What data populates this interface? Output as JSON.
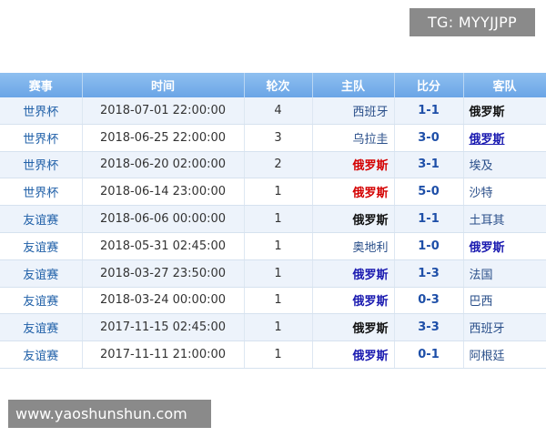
{
  "watermark_top": "TG: MYYJJPP",
  "watermark_bottom": "www.yaoshunshun.com",
  "headers": [
    "赛事",
    "时间",
    "轮次",
    "主队",
    "比分",
    "客队"
  ],
  "rows": [
    {
      "event": "世界杯",
      "time": "2018-07-01 22:00:00",
      "round": "4",
      "home": "西班牙",
      "home_style": "normal",
      "score": "1-1",
      "away": "俄罗斯",
      "away_style": "black"
    },
    {
      "event": "世界杯",
      "time": "2018-06-25 22:00:00",
      "round": "3",
      "home": "乌拉圭",
      "home_style": "normal",
      "score": "3-0",
      "away": "俄罗斯",
      "away_style": "link"
    },
    {
      "event": "世界杯",
      "time": "2018-06-20 02:00:00",
      "round": "2",
      "home": "俄罗斯",
      "home_style": "red",
      "score": "3-1",
      "away": "埃及",
      "away_style": "normal"
    },
    {
      "event": "世界杯",
      "time": "2018-06-14 23:00:00",
      "round": "1",
      "home": "俄罗斯",
      "home_style": "red",
      "score": "5-0",
      "away": "沙特",
      "away_style": "normal"
    },
    {
      "event": "友谊赛",
      "time": "2018-06-06 00:00:00",
      "round": "1",
      "home": "俄罗斯",
      "home_style": "black",
      "score": "1-1",
      "away": "土耳其",
      "away_style": "normal"
    },
    {
      "event": "友谊赛",
      "time": "2018-05-31 02:45:00",
      "round": "1",
      "home": "奥地利",
      "home_style": "normal",
      "score": "1-0",
      "away": "俄罗斯",
      "away_style": "blue"
    },
    {
      "event": "友谊赛",
      "time": "2018-03-27 23:50:00",
      "round": "1",
      "home": "俄罗斯",
      "home_style": "blue",
      "score": "1-3",
      "away": "法国",
      "away_style": "normal"
    },
    {
      "event": "友谊赛",
      "time": "2018-03-24 00:00:00",
      "round": "1",
      "home": "俄罗斯",
      "home_style": "blue",
      "score": "0-3",
      "away": "巴西",
      "away_style": "normal"
    },
    {
      "event": "友谊赛",
      "time": "2017-11-15 02:45:00",
      "round": "1",
      "home": "俄罗斯",
      "home_style": "black",
      "score": "3-3",
      "away": "西班牙",
      "away_style": "normal"
    },
    {
      "event": "友谊赛",
      "time": "2017-11-11 21:00:00",
      "round": "1",
      "home": "俄罗斯",
      "home_style": "blue",
      "score": "0-1",
      "away": "阿根廷",
      "away_style": "normal"
    }
  ]
}
